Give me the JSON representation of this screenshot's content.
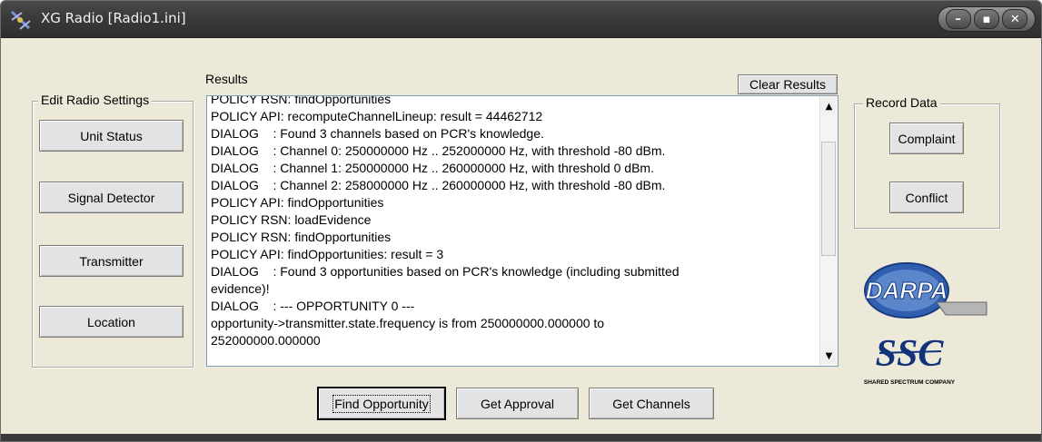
{
  "window": {
    "title": "XG Radio [Radio1.ini]",
    "controls": [
      "–",
      "▪",
      "✕"
    ]
  },
  "edit_settings": {
    "legend": "Edit Radio Settings",
    "buttons": [
      "Unit Status",
      "Signal Detector",
      "Transmitter",
      "Location"
    ]
  },
  "results": {
    "label": "Results",
    "clear_label": "Clear Results",
    "lines": [
      "POLICY RSN: findOpportunities",
      "POLICY API: recomputeChannelLineup: result = 44462712",
      "DIALOG    : Found 3 channels based on PCR's knowledge.",
      "DIALOG    : Channel 0: 250000000 Hz .. 252000000 Hz, with threshold -80 dBm.",
      "DIALOG    : Channel 1: 250000000 Hz .. 260000000 Hz, with threshold 0 dBm.",
      "DIALOG    : Channel 2: 258000000 Hz .. 260000000 Hz, with threshold -80 dBm.",
      "POLICY API: findOpportunities",
      "POLICY RSN: loadEvidence",
      "POLICY RSN: findOpportunities",
      "POLICY API: findOpportunities: result = 3",
      "DIALOG    : Found 3 opportunities based on PCR's knowledge (including submitted",
      "evidence)!",
      "DIALOG    : --- OPPORTUNITY 0 ---",
      "opportunity->transmitter.state.frequency is from 250000000.000000 to",
      "252000000.000000"
    ]
  },
  "record_data": {
    "legend": "Record Data",
    "complaint_label": "Complaint",
    "conflict_label": "Conflict"
  },
  "actions": {
    "find_label": "Find Opportunity",
    "approval_label": "Get Approval",
    "channels_label": "Get Channels"
  },
  "logos": {
    "darpa_text": "DARPA",
    "ssc_text": "SSC",
    "ssc_caption": "SHARED SPECTRUM COMPANY"
  }
}
